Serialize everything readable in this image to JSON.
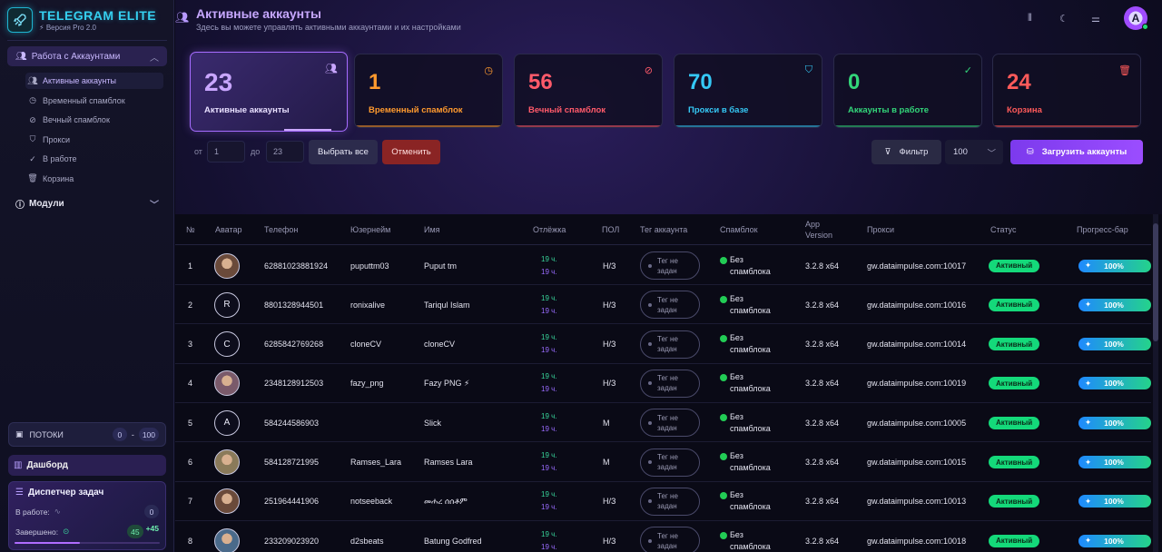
{
  "brand": {
    "title": "TELEGRAM ELITE",
    "version": "Версия Pro 2.0"
  },
  "sidebar": {
    "group_accounts": "Работа с Аккаунтами",
    "items": [
      {
        "label": "Активные аккаунты",
        "icon": "users-icon"
      },
      {
        "label": "Временный спамблок",
        "icon": "clock-icon"
      },
      {
        "label": "Вечный спамблок",
        "icon": "ban-icon"
      },
      {
        "label": "Прокси",
        "icon": "shield-icon"
      },
      {
        "label": "В работе",
        "icon": "check-icon"
      },
      {
        "label": "Корзина",
        "icon": "trash-icon"
      }
    ],
    "group_modules": "Модули",
    "threads": {
      "label": "ПОТОКИ",
      "from": "0",
      "to": "100"
    },
    "dashboard": "Дашборд",
    "tasks": {
      "title": "Диспетчер задач",
      "in_work_label": "В работе:",
      "in_work_value": "0",
      "done_label": "Завершено:",
      "done_value": "45",
      "done_delta": "+45"
    }
  },
  "header": {
    "title": "Активные аккаунты",
    "subtitle": "Здесь вы можете управлять активными аккаунтами и их настройками",
    "avatar_letter": "A"
  },
  "cards": [
    {
      "num": "23",
      "label": "Активные аккаунты",
      "color": "#c9a6ff",
      "icon": "users-icon"
    },
    {
      "num": "1",
      "label": "Временный спамблок",
      "color": "#ff9a2e",
      "icon": "clock-icon"
    },
    {
      "num": "56",
      "label": "Вечный спамблок",
      "color": "#ff5a6a",
      "icon": "ban-icon"
    },
    {
      "num": "70",
      "label": "Прокси в базе",
      "color": "#35c8f5",
      "icon": "shield-icon"
    },
    {
      "num": "0",
      "label": "Аккаунты в работе",
      "color": "#33d67a",
      "icon": "check-icon"
    },
    {
      "num": "24",
      "label": "Корзина",
      "color": "#ff5a5a",
      "icon": "trash-icon"
    }
  ],
  "controls": {
    "from_label": "от",
    "from_value": "1",
    "to_label": "до",
    "to_value": "23",
    "select_all": "Выбрать все",
    "cancel": "Отменить",
    "filter": "Фильтр",
    "count": "100",
    "upload": "Загрузить аккаунты"
  },
  "table": {
    "columns": [
      "№",
      "Аватар",
      "Телефон",
      "Юзернейм",
      "Имя",
      "Отлёжка",
      "ПОЛ",
      "Тег аккаунта",
      "Спамблок",
      "App Version",
      "Прокси",
      "Статус",
      "Прогресс-бар"
    ],
    "rows": [
      {
        "n": "1",
        "avatar": "",
        "phone": "62881023881924",
        "username": "puputtm03",
        "name": "Puput tm",
        "lag1": "19 ч.",
        "lag2": "19 ч.",
        "sex": "Н/З",
        "tag": "Тег не задан",
        "spam": "Без спамблока",
        "ver": "3.2.8 x64",
        "proxy": "gw.dataimpulse.com:10017",
        "status": "Активный",
        "progress": "100%"
      },
      {
        "n": "2",
        "avatar": "R",
        "phone": "8801328944501",
        "username": "ronixalive",
        "name": "Tariqul Islam",
        "lag1": "19 ч.",
        "lag2": "19 ч.",
        "sex": "Н/З",
        "tag": "Тег не задан",
        "spam": "Без спамблока",
        "ver": "3.2.8 x64",
        "proxy": "gw.dataimpulse.com:10016",
        "status": "Активный",
        "progress": "100%"
      },
      {
        "n": "3",
        "avatar": "C",
        "phone": "6285842769268",
        "username": "cloneCV",
        "name": "cloneCV",
        "lag1": "19 ч.",
        "lag2": "19 ч.",
        "sex": "Н/З",
        "tag": "Тег не задан",
        "spam": "Без спамблока",
        "ver": "3.2.8 x64",
        "proxy": "gw.dataimpulse.com:10014",
        "status": "Активный",
        "progress": "100%"
      },
      {
        "n": "4",
        "avatar": "",
        "phone": "2348128912503",
        "username": "fazy_png",
        "name": "Fazy PNG ⚡",
        "lag1": "19 ч.",
        "lag2": "19 ч.",
        "sex": "Н/З",
        "tag": "Тег не задан",
        "spam": "Без спамблока",
        "ver": "3.2.8 x64",
        "proxy": "gw.dataimpulse.com:10019",
        "status": "Активный",
        "progress": "100%"
      },
      {
        "n": "5",
        "avatar": "A",
        "phone": "584244586903",
        "username": "",
        "name": "Slick",
        "lag1": "19 ч.",
        "lag2": "19 ч.",
        "sex": "М",
        "tag": "Тег не задан",
        "spam": "Без спамблока",
        "ver": "3.2.8 x64",
        "proxy": "gw.dataimpulse.com:10005",
        "status": "Активный",
        "progress": "100%"
      },
      {
        "n": "6",
        "avatar": "",
        "phone": "584128721995",
        "username": "Ramses_Lara",
        "name": "Ramses Lara",
        "lag1": "19 ч.",
        "lag2": "19 ч.",
        "sex": "М",
        "tag": "Тег не задан",
        "spam": "Без спамблока",
        "ver": "3.2.8 x64",
        "proxy": "gw.dataimpulse.com:10015",
        "status": "Активный",
        "progress": "100%"
      },
      {
        "n": "7",
        "avatar": "",
        "phone": "251964441906",
        "username": "notseeback",
        "name": "መሐረ ሰሰቶም",
        "lag1": "19 ч.",
        "lag2": "19 ч.",
        "sex": "Н/З",
        "tag": "Тег не задан",
        "spam": "Без спамблока",
        "ver": "3.2.8 x64",
        "proxy": "gw.dataimpulse.com:10013",
        "status": "Активный",
        "progress": "100%"
      },
      {
        "n": "8",
        "avatar": "",
        "phone": "233209023920",
        "username": "d2sbeats",
        "name": "Batung Godfred",
        "lag1": "19 ч.",
        "lag2": "19 ч.",
        "sex": "Н/З",
        "tag": "Тег не задан",
        "spam": "Без спамблока",
        "ver": "3.2.8 x64",
        "proxy": "gw.dataimpulse.com:10018",
        "status": "Активный",
        "progress": "100%"
      }
    ]
  }
}
